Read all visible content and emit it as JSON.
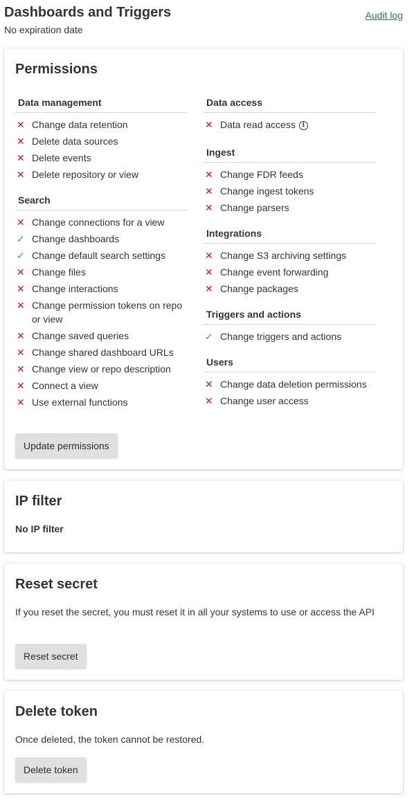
{
  "header": {
    "title": "Dashboards and Triggers",
    "subtitle": "No expiration date",
    "audit_link": "Audit log"
  },
  "permissions": {
    "title": "Permissions",
    "button": "Update permissions",
    "left_groups": [
      {
        "title": "Data management",
        "items": [
          {
            "label": "Change data retention",
            "granted": false
          },
          {
            "label": "Delete data sources",
            "granted": false
          },
          {
            "label": "Delete events",
            "granted": false
          },
          {
            "label": "Delete repository or view",
            "granted": false
          }
        ]
      },
      {
        "title": "Search",
        "items": [
          {
            "label": "Change connections for a view",
            "granted": false
          },
          {
            "label": "Change dashboards",
            "granted": true
          },
          {
            "label": "Change default search settings",
            "granted": true
          },
          {
            "label": "Change files",
            "granted": false
          },
          {
            "label": "Change interactions",
            "granted": false
          },
          {
            "label": "Change permission tokens on repo or view",
            "granted": false
          },
          {
            "label": "Change saved queries",
            "granted": false
          },
          {
            "label": "Change shared dashboard URLs",
            "granted": false
          },
          {
            "label": "Change view or repo description",
            "granted": false
          },
          {
            "label": "Connect a view",
            "granted": false
          },
          {
            "label": "Use external functions",
            "granted": false
          }
        ]
      }
    ],
    "right_groups": [
      {
        "title": "Data access",
        "items": [
          {
            "label": "Data read access",
            "granted": false,
            "info": true
          }
        ]
      },
      {
        "title": "Ingest",
        "items": [
          {
            "label": "Change FDR feeds",
            "granted": false
          },
          {
            "label": "Change ingest tokens",
            "granted": false
          },
          {
            "label": "Change parsers",
            "granted": false
          }
        ]
      },
      {
        "title": "Integrations",
        "items": [
          {
            "label": "Change S3 archiving settings",
            "granted": false
          },
          {
            "label": "Change event forwarding",
            "granted": false
          },
          {
            "label": "Change packages",
            "granted": false
          }
        ]
      },
      {
        "title": "Triggers and actions",
        "items": [
          {
            "label": "Change triggers and actions",
            "granted": true
          }
        ]
      },
      {
        "title": "Users",
        "items": [
          {
            "label": "Change data deletion permissions",
            "granted": false
          },
          {
            "label": "Change user access",
            "granted": false
          }
        ]
      }
    ],
    "icons": {
      "granted": "check-icon",
      "denied": "cross-icon",
      "info": "info-icon"
    },
    "colors": {
      "granted": "#3aa572",
      "denied": "#d0123a",
      "link": "#2f6f73"
    }
  },
  "ip_filter": {
    "title": "IP filter",
    "value": "No IP filter"
  },
  "reset_secret": {
    "title": "Reset secret",
    "description": "If you reset the secret, you must reset it in all your systems to use or access the API",
    "button": "Reset secret"
  },
  "delete_token": {
    "title": "Delete token",
    "description": "Once deleted, the token cannot be restored.",
    "button": "Delete token"
  }
}
